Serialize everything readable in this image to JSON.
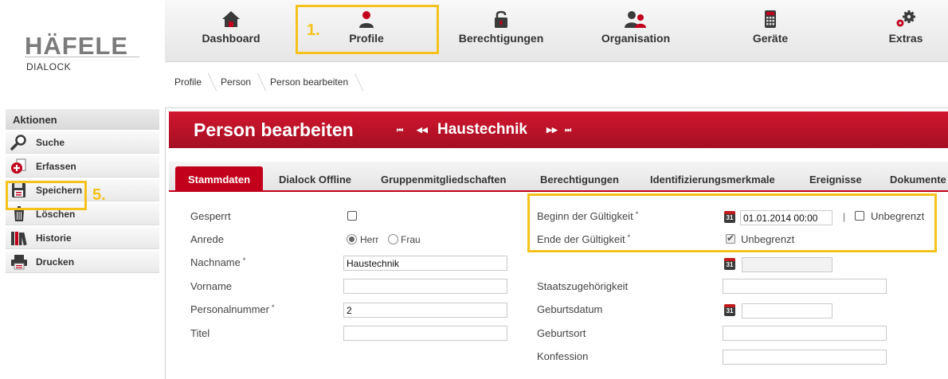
{
  "brand": {
    "logo": "HÄFELE",
    "sub": "DIALOCK"
  },
  "nav": [
    {
      "label": "Dashboard",
      "icon": "house-icon"
    },
    {
      "label": "Profile",
      "icon": "user-profile-icon"
    },
    {
      "label": "Berechtigungen",
      "icon": "padlock-icon"
    },
    {
      "label": "Organisation",
      "icon": "users-group-icon"
    },
    {
      "label": "Geräte",
      "icon": "device-keypad-icon"
    },
    {
      "label": "Extras",
      "icon": "gears-icon"
    }
  ],
  "highlights": {
    "profile_step": "1.",
    "save_step": "5."
  },
  "breadcrumb": [
    "Profile",
    "Person",
    "Person bearbeiten"
  ],
  "sidebar": {
    "title": "Aktionen",
    "items": [
      {
        "label": "Suche",
        "icon": "magnifier-icon"
      },
      {
        "label": "Erfassen",
        "icon": "add-icon"
      },
      {
        "label": "Speichern",
        "icon": "floppy-disk-icon"
      },
      {
        "label": "Löschen",
        "icon": "trash-icon"
      },
      {
        "label": "Historie",
        "icon": "books-icon"
      },
      {
        "label": "Drucken",
        "icon": "printer-icon"
      }
    ]
  },
  "page": {
    "title": "Person bearbeiten",
    "record_name": "Haustechnik",
    "nav_first": "⏮",
    "nav_prev": "◀◀",
    "nav_next": "▶▶",
    "nav_last": "⏭"
  },
  "tabs": [
    {
      "label": "Stammdaten",
      "active": true
    },
    {
      "label": "Dialock Offline",
      "active": false
    },
    {
      "label": "Gruppenmitgliedschaften",
      "active": false
    },
    {
      "label": "Berechtigungen",
      "active": false
    },
    {
      "label": "Identifizierungsmerkmale",
      "active": false
    },
    {
      "label": "Ereignisse",
      "active": false
    },
    {
      "label": "Dokumente",
      "active": false
    }
  ],
  "form": {
    "gesperrt": {
      "label": "Gesperrt",
      "checked": false
    },
    "anrede": {
      "label": "Anrede",
      "options": [
        "Herr",
        "Frau"
      ],
      "selected": "Herr"
    },
    "nachname": {
      "label": "Nachname",
      "required": "*",
      "value": "Haustechnik"
    },
    "vorname": {
      "label": "Vorname",
      "value": ""
    },
    "personalnummer": {
      "label": "Personalnummer",
      "required": "*",
      "value": "2"
    },
    "titel": {
      "label": "Titel",
      "value": ""
    },
    "beginn": {
      "label": "Beginn der Gültigkeit",
      "required": "*",
      "value": "01.01.2014 00:00",
      "separator": "|",
      "unbegrenzt_label": "Unbegrenzt",
      "unbegrenzt_checked": false
    },
    "ende": {
      "label": "Ende der Gültigkeit",
      "required": "*",
      "unbegrenzt_label": "Unbegrenzt",
      "unbegrenzt_checked": true,
      "value": ""
    },
    "staatszugehoerigkeit": {
      "label": "Staatszugehörigkeit",
      "value": ""
    },
    "geburtsdatum": {
      "label": "Geburtsdatum",
      "value": ""
    },
    "geburtsort": {
      "label": "Geburtsort",
      "value": ""
    },
    "konfession": {
      "label": "Konfession",
      "value": ""
    },
    "calendar_day": "31"
  },
  "colors": {
    "accent": "#c2001b",
    "highlight": "#f5c21b"
  }
}
